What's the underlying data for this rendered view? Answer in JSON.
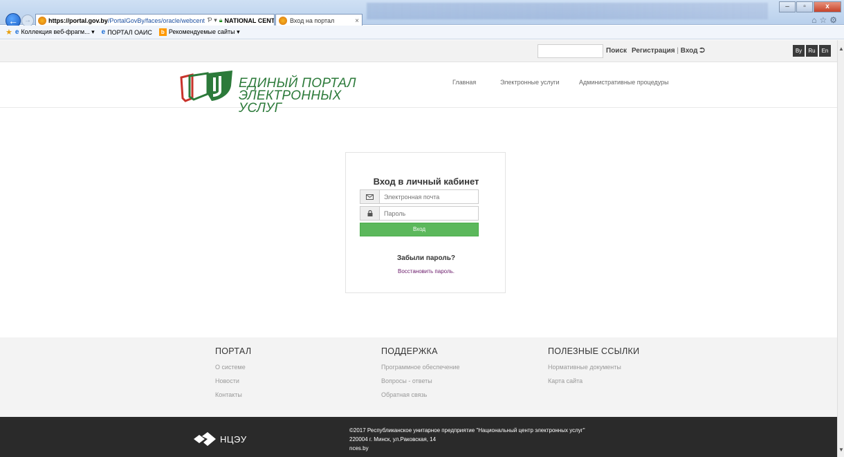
{
  "browser": {
    "address_host": "https://portal.gov.by",
    "address_path": "/PortalGovBy/faces/oracle/webcent",
    "address_tools": "Ƥ ▾",
    "cert_name": "NATIONAL CENTER OF ...",
    "refresh": "C",
    "tab_title": "Вход на портал",
    "tab_close": "×",
    "favorites": [
      {
        "label": "Коллекция веб-фрагм... ▾"
      },
      {
        "label": "ПОРТАЛ ОАИС"
      },
      {
        "label": "Рекомендуемые сайты ▾"
      }
    ],
    "win_minimize": "–",
    "win_maximize": "▫",
    "win_close": "x"
  },
  "topbar": {
    "search_label": "Поиск",
    "register_label": "Регистрация",
    "separator": "|",
    "login_label": "Вход",
    "login_icon": "⮊",
    "languages": [
      "By",
      "Ru",
      "En"
    ]
  },
  "header": {
    "logo_line1": "ЕДИНЫЙ ПОРТАЛ",
    "logo_line2": "ЭЛЕКТРОННЫХ УСЛУГ",
    "nav": [
      "Главная",
      "Электронные услуги",
      "Административные процедуры"
    ]
  },
  "login": {
    "title": "Вход в личный кабинет",
    "email_placeholder": "Электронная почта",
    "password_placeholder": "Пароль",
    "submit_label": "Вход",
    "forgot_title": "Забыли пароль?",
    "restore_link": "Восстановить пароль."
  },
  "footer": {
    "columns": [
      {
        "title": "ПОРТАЛ",
        "links": [
          "О системе",
          "Новости",
          "Контакты"
        ]
      },
      {
        "title": "ПОДДЕРЖКА",
        "links": [
          "Программное обеспечение",
          "Вопросы - ответы",
          "Обратная связь"
        ]
      },
      {
        "title": "ПОЛЕЗНЫЕ ССЫЛКИ",
        "links": [
          "Нормативные документы",
          "Карта сайта"
        ]
      }
    ],
    "org_logo_text": "НЦЭУ",
    "copyright": "©2017 Республиканское унитарное предприятие \"Национальный центр электронных услуг\"",
    "address": "220004 г. Минск, ул.Раковская, 14",
    "site": "nces.by"
  },
  "colors": {
    "brand_green": "#2c7a3a",
    "button_green": "#5cb85c",
    "footer_dark": "#2a2a2a"
  }
}
